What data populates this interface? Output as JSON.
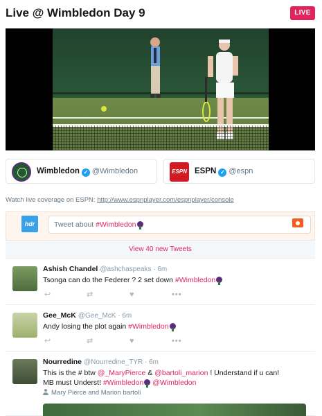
{
  "header": {
    "title": "Live @ Wimbledon Day 9",
    "live_badge": "LIVE"
  },
  "colors": {
    "accent": "#e0245e",
    "link_blue": "#1da1f2",
    "compose_bg": "#fff5ef",
    "camera_orange": "#f45d22"
  },
  "profiles": [
    {
      "name": "Wimbledon",
      "handle": "@Wimbledon",
      "verified": true,
      "logo_icon": "wimbledon-logo-icon"
    },
    {
      "name": "ESPN",
      "handle": "@espn",
      "verified": true,
      "logo_text": "ESPN",
      "logo_icon": "espn-logo-icon"
    }
  ],
  "watch": {
    "text": "Watch live coverage on ESPN: ",
    "link": "http://www.espnplayer.com/espnplayer/console"
  },
  "compose": {
    "avatar_text": "hdr",
    "placeholder": "Tweet about ",
    "hashtag": "#Wimbledon",
    "camera_icon": "camera-icon"
  },
  "new_tweets": "View 40 new Tweets",
  "tweets": [
    {
      "name": "Ashish Chandel",
      "meta": "@ashchaspeaks · 6m",
      "text": "Tsonga can do the Federer ? 2 set down ",
      "hashtag": "#Wimbledon"
    },
    {
      "name": "Gee_McK",
      "meta": "@Gee_McK · 6m",
      "text": "Andy losing the plot again ",
      "hashtag": "#Wimbledon"
    },
    {
      "name": "Nourredine",
      "meta": "@Nourredine_TYR · 6m",
      "line1_a": "This is the # btw ",
      "mention1": "@_MaryPierce",
      "line1_b": " & ",
      "mention2": "@bartoli_marion",
      "line1_c": " ! Understand if u can!",
      "line2_a": "MB must Underst! ",
      "hashtag": "#Wimbledon",
      "mention3": "@Wimbledon",
      "tagged": "Mary Pierce and Marion bartoli"
    }
  ],
  "actions": {
    "reply_icon": "reply-icon",
    "retweet_icon": "retweet-icon",
    "like_icon": "heart-icon",
    "more_icon": "more-icon"
  }
}
